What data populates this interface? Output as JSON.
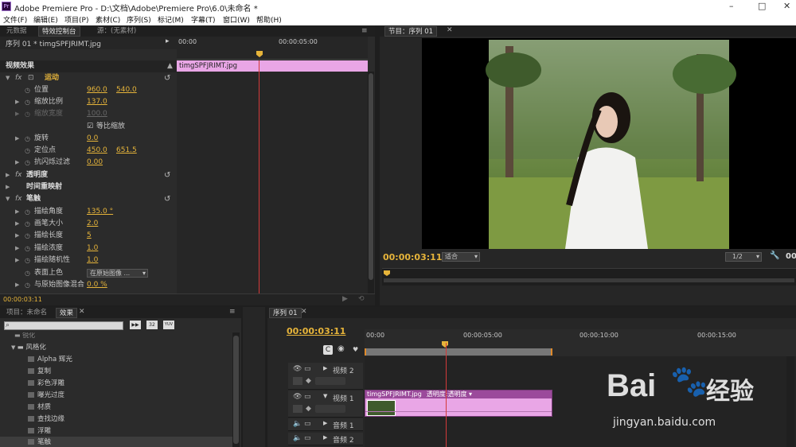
{
  "window": {
    "title": "Adobe Premiere Pro - D:\\文档\\Adobe\\Premiere Pro\\6.0\\未命名 *",
    "logo": "Pr",
    "minimize": "–",
    "maximize": "□",
    "close": "✕"
  },
  "menu": [
    "文件(F)",
    "编辑(E)",
    "项目(P)",
    "素材(C)",
    "序列(S)",
    "标记(M)",
    "字幕(T)",
    "窗口(W)",
    "帮助(H)"
  ],
  "effect_controls": {
    "tabs": [
      "元数据",
      "特效控制台",
      "源：(无素材)"
    ],
    "clip_path": "序列 01 * timgSPFJRIMT.jpg",
    "ruler": [
      "00:00",
      "00:00:05:00"
    ],
    "clip_label": "timgSPFJRIMT.jpg",
    "section": "视频效果",
    "motion": "运动",
    "position": {
      "label": "位置",
      "x": "960.0",
      "y": "540.0"
    },
    "scale": {
      "label": "缩放比例",
      "v": "137.0"
    },
    "scale_width": {
      "label": "缩放宽度",
      "v": "100.0"
    },
    "uniform": "等比缩放",
    "rotation": {
      "label": "旋转",
      "v": "0.0"
    },
    "anchor": {
      "label": "定位点",
      "x": "450.0",
      "y": "651.5"
    },
    "flicker": {
      "label": "抗闪烁过滤",
      "v": "0.00"
    },
    "opacity": "透明度",
    "time_remap": "时间重映射",
    "brush": "笔触",
    "stroke_angle": {
      "label": "描绘角度",
      "v": "135.0 °"
    },
    "brush_size": {
      "label": "画笔大小",
      "v": "2.0"
    },
    "stroke_length": {
      "label": "描绘长度",
      "v": "5"
    },
    "stroke_density": {
      "label": "描绘浓度",
      "v": "1.0"
    },
    "stroke_random": {
      "label": "描绘随机性",
      "v": "1.0"
    },
    "paint_surface": {
      "label": "表面上色",
      "v": "在原始图像 ..."
    },
    "blend": {
      "label": "与原始图像混合",
      "v": "0.0 %"
    },
    "timecode": "00:00:03:11"
  },
  "program": {
    "tab": "节目：序列 01",
    "timecode": "00:00:03:11",
    "fit": "适合",
    "res": "1/2",
    "dur": "00",
    "buttons": [
      "♥",
      "{",
      "}",
      "{←",
      "◀|",
      "▶",
      "|▶",
      "→}",
      "⊟",
      "⊞",
      "📷"
    ]
  },
  "project": {
    "tabs": [
      "项目：未命名",
      "效果"
    ],
    "search_placeholder": "",
    "btns": [
      "▶▶",
      "32",
      "YUV"
    ],
    "folder_partial": "锐化",
    "folder": "风格化",
    "items": [
      "Alpha 辉光",
      "复制",
      "彩色浮雕",
      "曝光过度",
      "材质",
      "查找边缘",
      "浮雕",
      "笔触"
    ]
  },
  "timeline": {
    "tab": "序列 01",
    "timecode": "00:00:03:11",
    "ruler": [
      "00:00",
      "00:00:05:00",
      "00:00:10:00",
      "00:00:15:00"
    ],
    "tracks": {
      "v2": "视频 2",
      "v1": "视频 1",
      "a1": "音频 1",
      "a2": "音频 2"
    },
    "clip": "timgSPFJRIMT.jpg",
    "clip_fx": "透明度:透明度 ▾"
  },
  "watermark": {
    "brand": "Bai",
    "brand2": "经验",
    "url": "jingyan.baidu.com"
  },
  "colors": {
    "accent": "#e6b43a",
    "clip": "#e9a6e6",
    "clipbar": "#9b4a9b",
    "playhead": "#d43a3a"
  }
}
